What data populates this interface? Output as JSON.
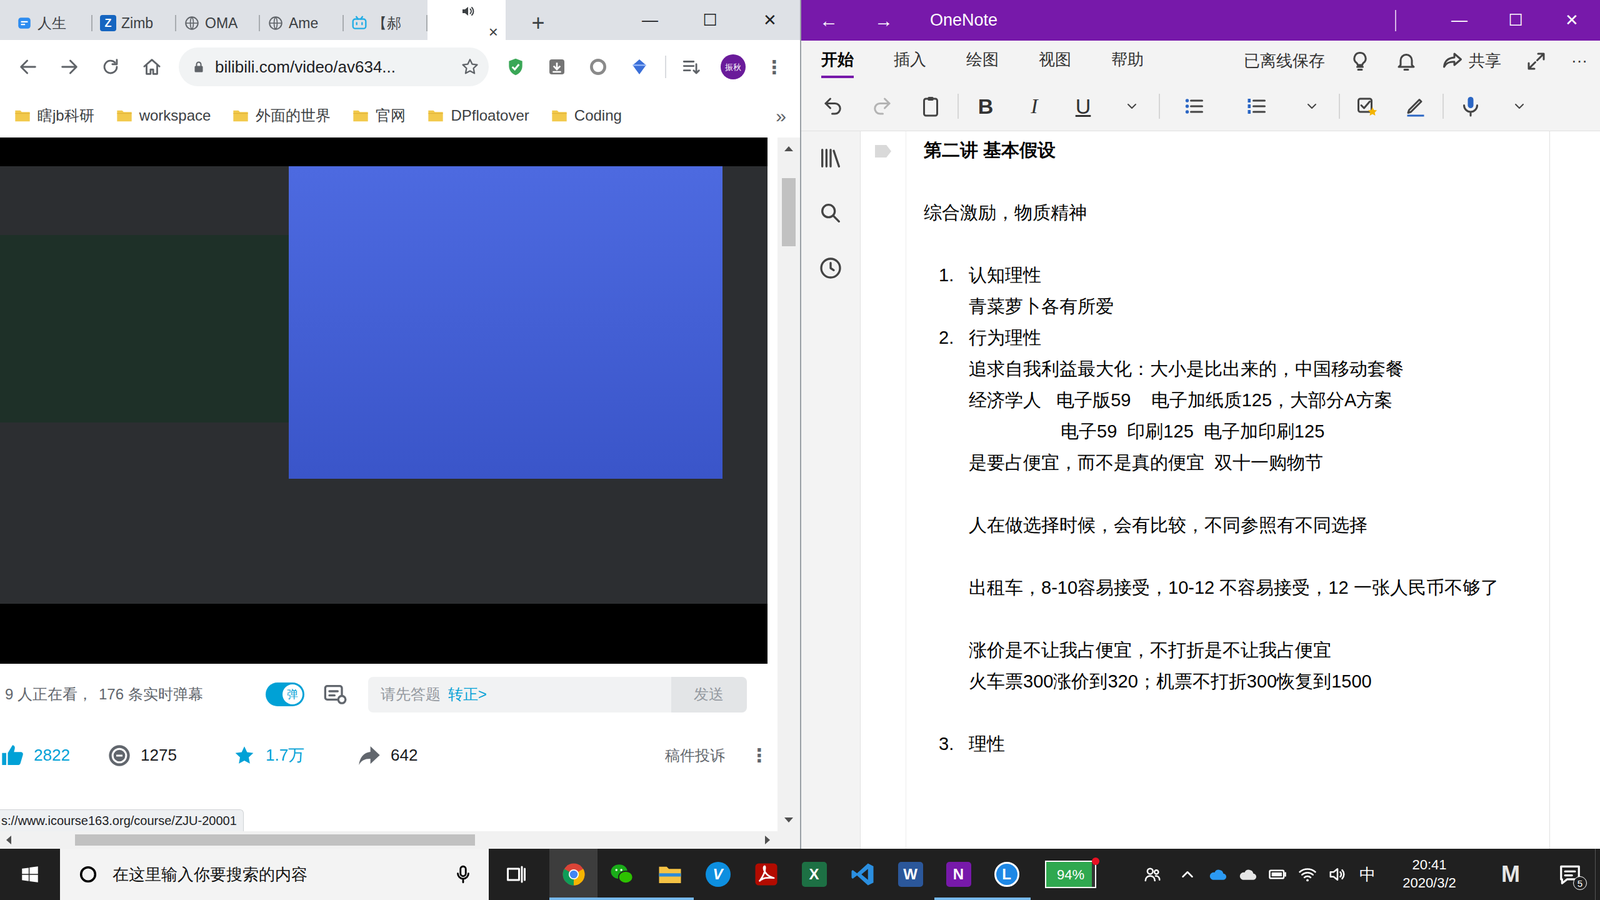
{
  "browser": {
    "tabs": [
      {
        "kind": "note",
        "label": "人生",
        "selected": false
      },
      {
        "kind": "letter",
        "glyph": "Z",
        "label": "Zimb",
        "selected": false
      },
      {
        "kind": "globe",
        "label": "OMA",
        "selected": false
      },
      {
        "kind": "globe",
        "label": "Ame",
        "selected": false
      },
      {
        "kind": "tv",
        "label": "【郝",
        "selected": false
      },
      {
        "kind": "tv",
        "selected": true,
        "audio": true,
        "close": "×"
      }
    ],
    "new_tab": "+",
    "window_controls": [
      "—",
      "☐",
      "✕"
    ],
    "address": "bilibili.com/video/av634...",
    "profile": "振秋",
    "menu": "⋮",
    "bookmarks": [
      "瞎jb科研",
      "workspace",
      "外面的世界",
      "官网",
      "DPfloatover",
      "Coding"
    ],
    "bookmarks_more": "»",
    "player": {
      "viewers": "9 人正在看，",
      "danmaku_count": "176 条实时弹幕",
      "danmaku_toggle": {
        "label": "弹",
        "on": true
      },
      "input_placeholder": "请先答题",
      "input_link": "转正>",
      "send": "发送"
    },
    "stats": [
      {
        "kind": "like",
        "value": "2822",
        "active": true
      },
      {
        "kind": "coin",
        "value": "1275",
        "active": false
      },
      {
        "kind": "favorite",
        "value": "1.7万",
        "active": true
      },
      {
        "kind": "share",
        "value": "642",
        "active": false
      }
    ],
    "report": "稿件投诉",
    "more": "⋮",
    "status_url": "s://www.icourse163.org/course/ZJU-20001"
  },
  "onenote": {
    "nav": [
      "←",
      "→"
    ],
    "title": "OneNote",
    "window_controls": [
      "—",
      "☐",
      "✕"
    ],
    "menu": [
      {
        "label": "开始",
        "selected": true
      },
      {
        "label": "插入",
        "selected": false
      },
      {
        "label": "绘图",
        "selected": false
      },
      {
        "label": "视图",
        "selected": false
      },
      {
        "label": "帮助",
        "selected": false
      }
    ],
    "save_status": "已离线保存",
    "share": "共享",
    "more": "···",
    "history": {
      "undo_enabled": true,
      "redo_enabled": false
    },
    "format": [
      {
        "kind": "bold",
        "label": "B"
      },
      {
        "kind": "italic",
        "label": "I"
      },
      {
        "kind": "underline",
        "label": "U"
      }
    ],
    "page": {
      "title": "第二讲 基本假设",
      "lines": [
        {
          "kind": "para",
          "text": "综合激励，物质精神"
        },
        {
          "kind": "blank"
        },
        {
          "kind": "item",
          "number": "1.",
          "text": "认知理性"
        },
        {
          "kind": "sub",
          "text": "青菜萝卜各有所爱"
        },
        {
          "kind": "item",
          "number": "2.",
          "text": "行为理性"
        },
        {
          "kind": "sub",
          "text": "追求自我利益最大化：大小是比出来的，中国移动套餐"
        },
        {
          "kind": "sub",
          "text": "经济学人   电子版59    电子加纸质125，大部分A方案"
        },
        {
          "kind": "subsub",
          "text": "电子59  印刷125  电子加印刷125"
        },
        {
          "kind": "sub",
          "text": "是要占便宜，而不是真的便宜  双十一购物节"
        },
        {
          "kind": "blank"
        },
        {
          "kind": "sub",
          "text": "人在做选择时候，会有比较，不同参照有不同选择"
        },
        {
          "kind": "blank"
        },
        {
          "kind": "sub",
          "text": "出租车，8-10容易接受，10-12 不容易接受，12 一张人民币不够了"
        },
        {
          "kind": "blank"
        },
        {
          "kind": "sub",
          "text": "涨价是不让我占便宜，不打折是不让我占便宜"
        },
        {
          "kind": "sub",
          "text": "火车票300涨价到320；机票不打折300恢复到1500"
        },
        {
          "kind": "blank"
        },
        {
          "kind": "item",
          "number": "3.",
          "text": "理性"
        }
      ]
    }
  },
  "taskbar": {
    "search_placeholder": "在这里输入你要搜索的内容",
    "apps": [
      {
        "kind": "chrome",
        "running": true,
        "selected": true
      },
      {
        "kind": "wechat",
        "running": true,
        "selected": false
      },
      {
        "kind": "explorer",
        "running": true,
        "selected": false
      },
      {
        "kind": "vlogo",
        "glyph": "V",
        "running": false,
        "selected": false
      },
      {
        "kind": "acrobat",
        "running": false,
        "selected": false
      },
      {
        "kind": "excel",
        "glyph": "X",
        "running": false,
        "selected": false
      },
      {
        "kind": "vscode",
        "running": false,
        "selected": false
      },
      {
        "kind": "word",
        "glyph": "W",
        "running": false,
        "selected": false
      },
      {
        "kind": "onenote",
        "glyph": "N",
        "running": true,
        "selected": false
      },
      {
        "kind": "lapp",
        "glyph": "L",
        "running": true,
        "selected": false
      }
    ],
    "battery_widget": {
      "reading": "94%",
      "level": 0.94,
      "alert": true
    },
    "tray": [
      {
        "kind": "people"
      },
      {
        "kind": "chevron"
      },
      {
        "kind": "onedrive"
      },
      {
        "kind": "cloud"
      },
      {
        "kind": "battery"
      },
      {
        "kind": "wifi"
      },
      {
        "kind": "volume"
      }
    ],
    "ime": "中",
    "time": "20:41",
    "date": "2020/3/2",
    "corner_app": "M",
    "notifications": "5"
  }
}
